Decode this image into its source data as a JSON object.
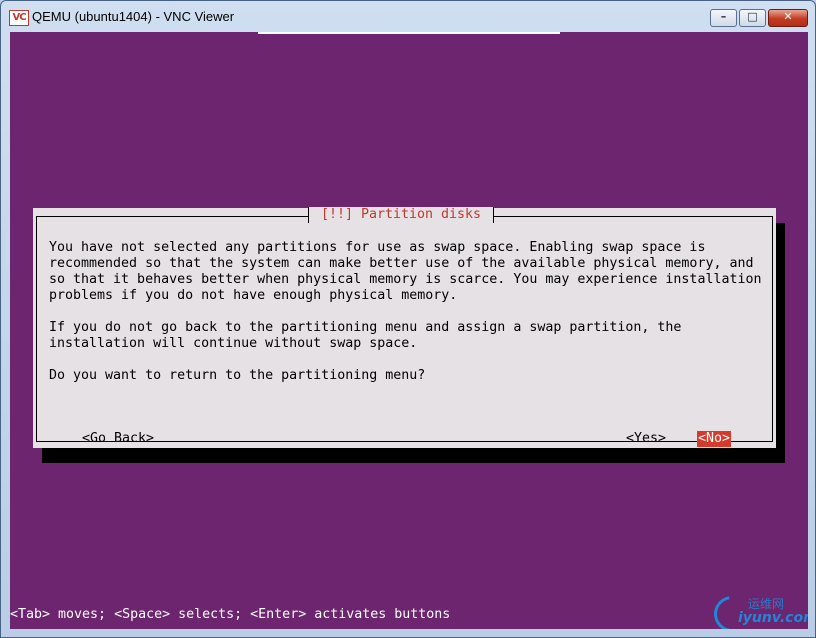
{
  "window": {
    "title": "QEMU (ubuntu1404) - VNC Viewer",
    "app_icon_label": "VC",
    "controls": {
      "minimize": "–",
      "maximize": "□",
      "close": "✕"
    }
  },
  "dialog": {
    "title": "[!!] Partition disks",
    "paragraphs": [
      "You have not selected any partitions for use as swap space. Enabling swap space is\nrecommended so that the system can make better use of the available physical memory, and\nso that it behaves better when physical memory is scarce. You may experience installation\nproblems if you do not have enough physical memory.",
      "If you do not go back to the partitioning menu and assign a swap partition, the\ninstallation will continue without swap space.",
      "Do you want to return to the partitioning menu?"
    ],
    "buttons": {
      "go_back": "<Go Back>",
      "yes": "<Yes>",
      "no": "<No>"
    }
  },
  "status_line": "<Tab> moves; <Space> selects; <Enter> activates buttons",
  "watermark": {
    "cn": "运维网",
    "url": "iyunv.com"
  },
  "colors": {
    "background": "#6e256f",
    "dialog": "#e6e1e5",
    "title_text": "#c0392b",
    "selected_button": "#d63a2a"
  }
}
